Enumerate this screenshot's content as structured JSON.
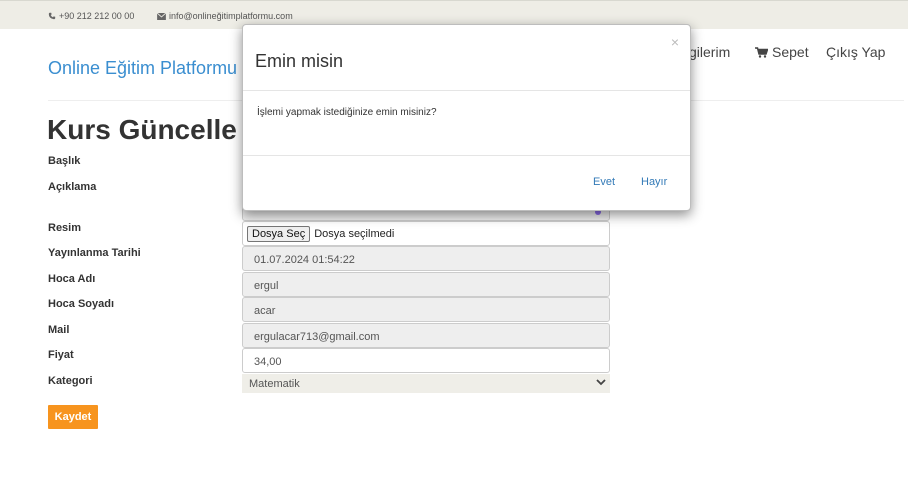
{
  "topbar": {
    "phone": "+90 212 212 00 00",
    "email": "info@onlineğitimplatformu.com"
  },
  "header": {
    "brand": "Online Eğitim Platformu",
    "nav": [
      {
        "label": "ılgilerim",
        "icon": ""
      },
      {
        "label": "Sepet",
        "icon": "cart-icon"
      },
      {
        "label": "Çıkış Yap",
        "icon": ""
      }
    ]
  },
  "form": {
    "title": "Kurs Güncelle",
    "labels": {
      "baslik": "Başlık",
      "aciklama": "Açıklama",
      "resim": "Resim",
      "yayinlanma": "Yayınlanma Tarihi",
      "hoca_adi": "Hoca Adı",
      "hoca_soyadi": "Hoca Soyadı",
      "mail": "Mail",
      "fiyat": "Fiyat",
      "kategori": "Kategori"
    },
    "file_button": "Dosya Seç",
    "file_status": "Dosya seçilmedi",
    "values": {
      "yayinlanma": "01.07.2024 01:54:22",
      "hoca_adi": "ergul",
      "hoca_soyadi": "acar",
      "mail": "ergulacar713@gmail.com",
      "fiyat": "34,00",
      "kategori": "Matematik"
    },
    "save_label": "Kaydet"
  },
  "modal": {
    "title": "Emin misin",
    "close": "×",
    "body": "İşlemi yapmak istediğinize emin misiniz?",
    "yes": "Evet",
    "no": "Hayır"
  },
  "colors": {
    "brand": "#3a8ed0",
    "save_button": "#f7941e",
    "link": "#337ab7",
    "topbar": "#eeede6"
  }
}
